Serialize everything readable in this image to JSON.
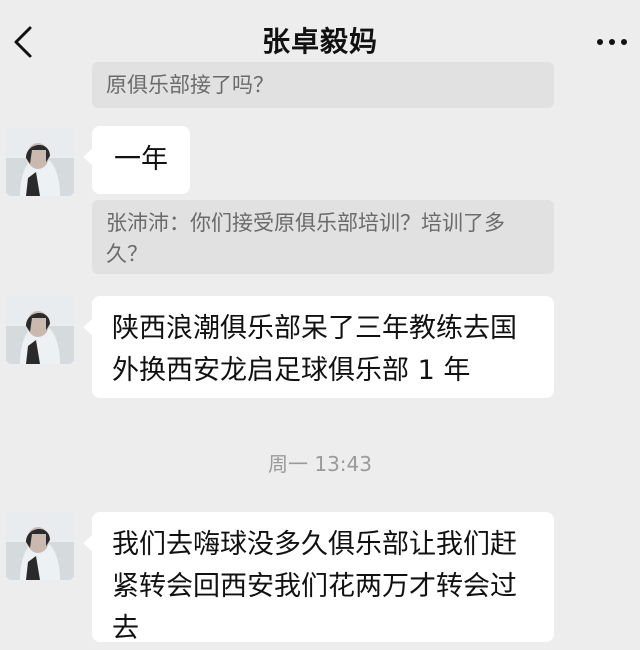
{
  "header": {
    "title": "张卓毅妈",
    "back_icon": "chevron-left-icon",
    "more_icon": "more-dots-icon"
  },
  "messages": [
    {
      "type": "quote",
      "text": "原俱乐部接了吗？"
    },
    {
      "type": "received",
      "text": "一年"
    },
    {
      "type": "quote",
      "text": "张沛沛：你们接受原俱乐部培训？培训了多久？"
    },
    {
      "type": "received",
      "text": "陕西浪潮俱乐部呆了三年教练去国外换西安龙启足球俱乐部 1 年"
    },
    {
      "type": "timestamp",
      "text": "周一 13:43"
    },
    {
      "type": "received",
      "text": "我们去嗨球没多久俱乐部让我们赶紧转会回西安我们花两万才转会过去"
    }
  ],
  "colors": {
    "background": "#ededed",
    "bubble": "#ffffff",
    "quote": "#e1e1e1",
    "quote_text": "#6b6b6b",
    "timestamp_text": "#9a9a9a"
  }
}
